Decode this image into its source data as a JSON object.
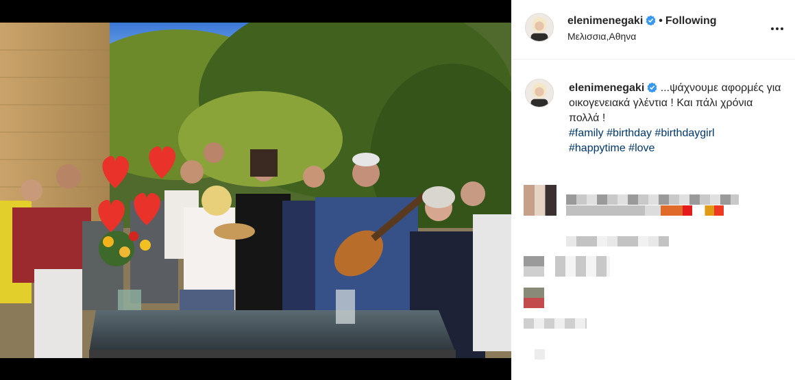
{
  "post": {
    "username": "elenimenegaki",
    "separator": "•",
    "following_label": "Following",
    "location": "Μελισσια,Αθηνα",
    "caption_line1": "...ψάχνουμε αφορμές για οικογενειακά γλέντια ! Και πάλι χρόνια πολλά !",
    "hashtags": [
      "#family",
      "#birthday",
      "#birthdaygirl",
      "#happytime",
      "#love"
    ]
  },
  "icons": {
    "verified": "verified-badge-icon",
    "more": "more-options-icon",
    "hearts": "heart-emoji-icon"
  },
  "colors": {
    "verified_blue": "#3897f0",
    "hashtag": "#00376b",
    "text": "#262626",
    "heart": "#e8322a"
  }
}
